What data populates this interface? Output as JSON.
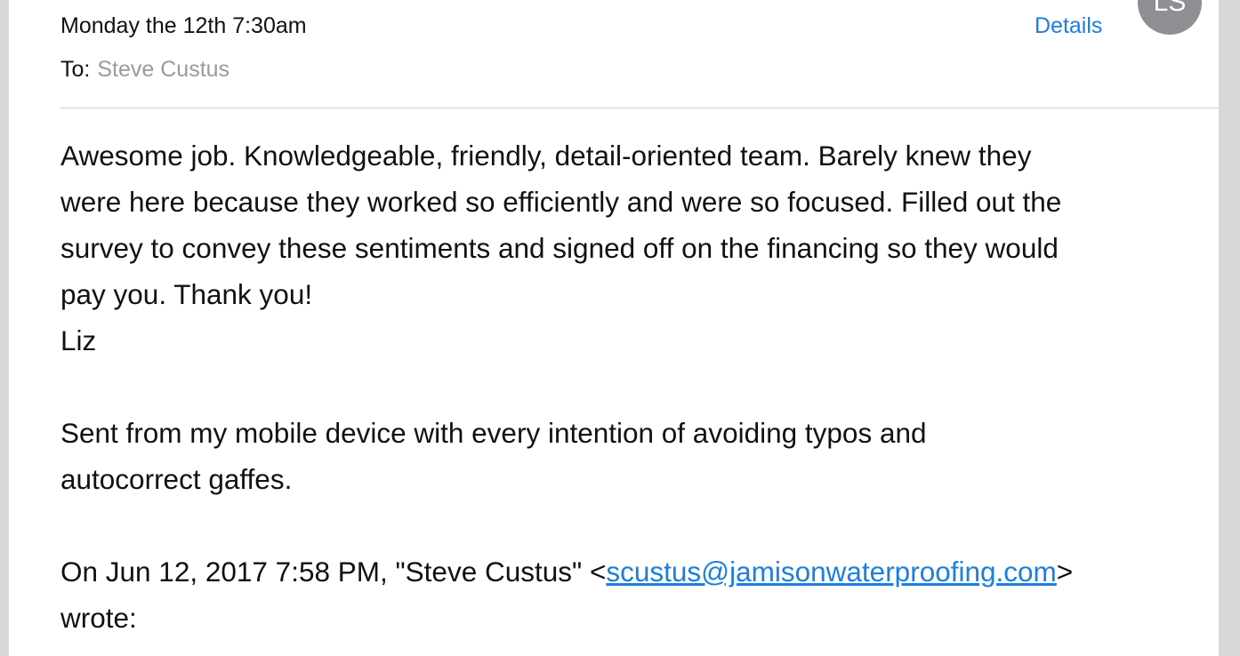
{
  "header": {
    "date": "Monday the 12th 7:30am",
    "to_label": "To:",
    "to_value": "Steve Custus",
    "details_label": "Details",
    "avatar_initials": "LS"
  },
  "body": {
    "lines": [
      "Awesome job. Knowledgeable, friendly, detail-oriented team. Barely knew they",
      "were here because they worked so efficiently and were so focused. Filled out the",
      "survey to convey these sentiments and signed off on the financing so they would",
      "pay you. Thank you!",
      "Liz"
    ],
    "signature_lines": [
      "Sent from my mobile device with every intention of avoiding typos and",
      "autocorrect gaffes."
    ],
    "quote": {
      "prefix": "On Jun 12, 2017 7:58 PM, \"Steve Custus\" <",
      "email": "scustus@jamisonwaterproofing.com",
      "suffix": ">",
      "line2": "wrote:"
    }
  },
  "colors": {
    "accent": "#1a7fe0",
    "avatar_bg": "#8e8e93",
    "muted_text": "#9a9a9a",
    "background": "#d7d7d7"
  }
}
